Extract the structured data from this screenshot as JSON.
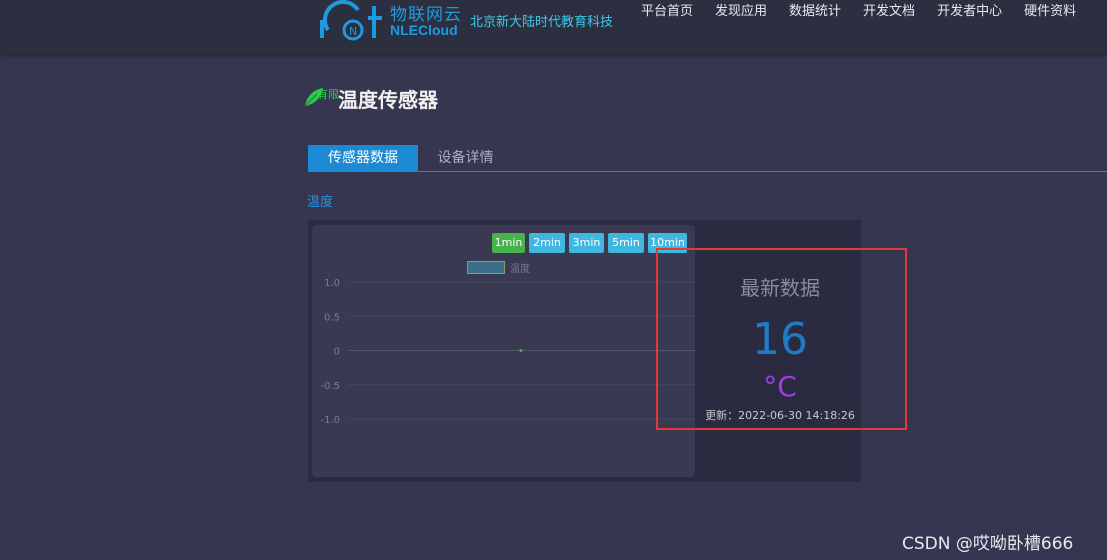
{
  "header": {
    "logo_cn": "物联网云",
    "logo_en": "NLECloud",
    "company": "北京新大陆时代教育科技",
    "nav": [
      "平台首页",
      "发现应用",
      "数据统计",
      "开发文档",
      "开发者中心",
      "硬件资料"
    ]
  },
  "page": {
    "title": "温度传感器",
    "badge": "有限"
  },
  "tabs": [
    {
      "label": "传感器数据",
      "active": true
    },
    {
      "label": "设备详情",
      "active": false
    }
  ],
  "section_label": "温度",
  "range_buttons": [
    "1min",
    "2min",
    "3min",
    "5min",
    "10min"
  ],
  "chart_data": {
    "type": "line",
    "series": [
      {
        "name": "温度",
        "values": [
          0
        ]
      }
    ],
    "y_ticks": [
      "1.0",
      "0.5",
      "0",
      "-0.5",
      "-1.0"
    ],
    "ylim": [
      -1.0,
      1.0
    ],
    "grid": true,
    "legend": "top-center",
    "colors": {
      "series": "#46b24a"
    }
  },
  "latest": {
    "title": "最新数据",
    "value": "16",
    "unit": "°C",
    "update": "更新：2022-06-30 14:18:26"
  },
  "watermark": "CSDN @哎呦卧槽666"
}
